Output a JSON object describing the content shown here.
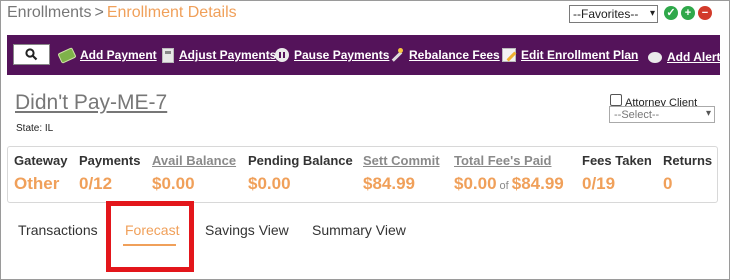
{
  "breadcrumb": {
    "root": "Enrollments",
    "separator": ">",
    "current": "Enrollment Details"
  },
  "favorites": {
    "selected": "--Favorites--",
    "arrow": "▾"
  },
  "header_actions": [
    {
      "name": "check-circle-icon",
      "glyph": "✓",
      "color": "#2fa84a"
    },
    {
      "name": "add-circle-icon",
      "glyph": "+",
      "color": "#2fa84a"
    },
    {
      "name": "remove-circle-icon",
      "glyph": "−",
      "color": "#d23a2a"
    }
  ],
  "toolbar": {
    "background": "#54135a",
    "search_icon": "search-icon",
    "items": [
      {
        "label": "Add Payment",
        "icon": "money-icon"
      },
      {
        "label": "Adjust Payments",
        "icon": "calculator-icon"
      },
      {
        "label": "Pause Payments",
        "icon": "pause-icon"
      },
      {
        "label": "Rebalance Fees",
        "icon": "magic-wand-icon"
      },
      {
        "label": "Edit Enrollment Plan",
        "icon": "edit-icon"
      },
      {
        "label": "Add Alert",
        "icon": "speech-bubble-icon"
      }
    ]
  },
  "client": {
    "name": "Didn't Pay-ME-7",
    "state": "State: IL",
    "attorney_label": "Attorney Client",
    "attorney_checked": false,
    "select_value": "--Select--"
  },
  "stats": [
    {
      "label": "Gateway",
      "value": "Other",
      "link": false
    },
    {
      "label": "Payments",
      "value": "0/12",
      "link": false
    },
    {
      "label": "Avail Balance",
      "value": "$0.00",
      "link": true
    },
    {
      "label": "Pending Balance",
      "value": "$0.00",
      "link": false
    },
    {
      "label": "Sett Commit",
      "value": "$84.99",
      "link": true
    },
    {
      "label": "Total Fee's Paid",
      "value": "$0.00",
      "of": "of",
      "value2": "$84.99",
      "link": true
    },
    {
      "label": "Fees Taken",
      "value": "0/19",
      "link": false
    },
    {
      "label": "Returns",
      "value": "0",
      "link": false
    }
  ],
  "tabs": [
    {
      "label": "Transactions",
      "active": false
    },
    {
      "label": "Forecast",
      "active": true
    },
    {
      "label": "Savings View",
      "active": false
    },
    {
      "label": "Summary View",
      "active": false
    }
  ],
  "colors": {
    "accent": "#f0a05a",
    "highlight": "#e3161b",
    "toolbar": "#54135a"
  }
}
